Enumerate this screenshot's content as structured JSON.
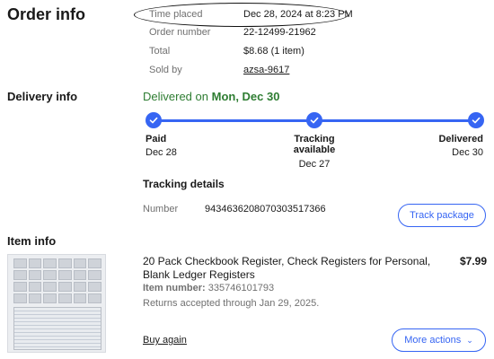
{
  "order_info": {
    "title": "Order info",
    "time_placed_label": "Time placed",
    "time_placed_value": "Dec 28, 2024 at 8:23 PM",
    "order_number_label": "Order number",
    "order_number_value": "22-12499-21962",
    "total_label": "Total",
    "total_value": "$8.68 (1 item)",
    "sold_by_label": "Sold by",
    "sold_by_value": "azsa-9617"
  },
  "delivery_info": {
    "title": "Delivery info",
    "status_prefix": "Delivered on ",
    "status_date": "Mon, Dec 30",
    "steps": [
      {
        "label": "Paid",
        "date": "Dec 28"
      },
      {
        "label": "Tracking available",
        "date": "Dec 27"
      },
      {
        "label": "Delivered",
        "date": "Dec 30"
      }
    ],
    "tracking_details_title": "Tracking details",
    "number_label": "Number",
    "tracking_number": "9434636208070303517366",
    "track_button": "Track package"
  },
  "item_info": {
    "title": "Item info",
    "item_title": "20 Pack Checkbook Register, Check Registers for Personal, Blank Ledger Registers",
    "price": "$7.99",
    "item_number_label": "Item number:",
    "item_number_value": "335746101793",
    "returns": "Returns accepted through Jan 29, 2025.",
    "buy_again": "Buy again",
    "more_actions": "More actions"
  },
  "colors": {
    "accent": "#3665f3",
    "delivered_green": "#2e7d32",
    "muted_text": "#707070"
  }
}
